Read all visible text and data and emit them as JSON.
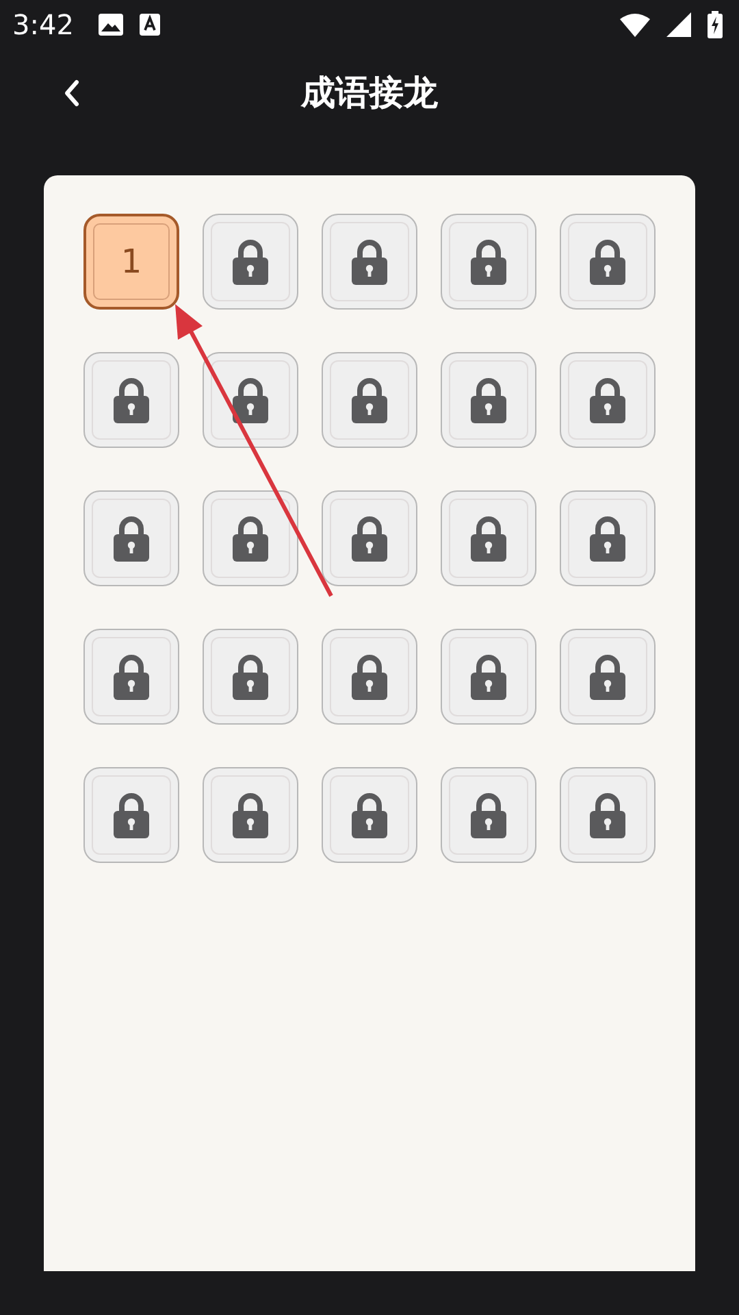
{
  "status_bar": {
    "time": "3:42"
  },
  "header": {
    "title": "成语接龙"
  },
  "levels": [
    {
      "locked": false,
      "label": "1"
    },
    {
      "locked": true
    },
    {
      "locked": true
    },
    {
      "locked": true
    },
    {
      "locked": true
    },
    {
      "locked": true
    },
    {
      "locked": true
    },
    {
      "locked": true
    },
    {
      "locked": true
    },
    {
      "locked": true
    },
    {
      "locked": true
    },
    {
      "locked": true
    },
    {
      "locked": true
    },
    {
      "locked": true
    },
    {
      "locked": true
    },
    {
      "locked": true
    },
    {
      "locked": true
    },
    {
      "locked": true
    },
    {
      "locked": true
    },
    {
      "locked": true
    },
    {
      "locked": true
    },
    {
      "locked": true
    },
    {
      "locked": true
    },
    {
      "locked": true
    },
    {
      "locked": true
    }
  ]
}
